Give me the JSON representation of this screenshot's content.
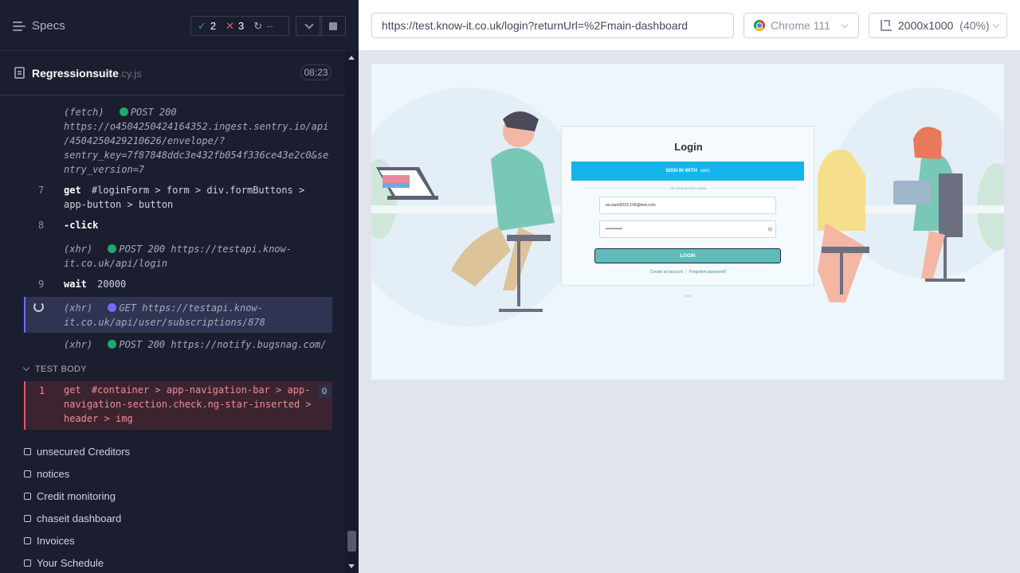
{
  "reporter": {
    "specs_label": "Specs",
    "stats": {
      "passed": "2",
      "failed": "3",
      "pending": "--"
    },
    "spec_file": {
      "name": "Regressionsuite",
      "ext": ".cy.js",
      "duration": "08:23"
    },
    "log": [
      {
        "kind": "fetch",
        "label": "(fetch)",
        "method": "POST 200",
        "text": "https://o4504250424164352.ingest.sentry.io/api/4504250429210626/envelope/?sentry_key=7f87848ddc3e432fb054f336ce43e2c0&sentry_version=7",
        "line1": "https://o4504250424164352.ingest.sentry.io/api",
        "line2": "/4504250429210626/envelope/?",
        "line3": "sentry_key=7f87848ddc3e432fb054f336ce43e2c0&se",
        "line4": "ntry_version=7"
      },
      {
        "kind": "cmd",
        "num": "7",
        "cmd": "get",
        "arg1": "#loginForm > form > div.formButtons >",
        "arg2": "app-button > button"
      },
      {
        "kind": "cmd",
        "num": "8",
        "cmd": "-click"
      },
      {
        "kind": "xhr",
        "label": "(xhr)",
        "method": "POST 200",
        "line1": "https://testapi.know-",
        "line2": "it.co.uk/api/login"
      },
      {
        "kind": "cmd",
        "num": "9",
        "cmd": "wait",
        "arg1": "20000"
      },
      {
        "kind": "xhr-active",
        "label": "(xhr)",
        "method": "GET",
        "line1": "https://testapi.know-",
        "line2": "it.co.uk/api/user/subscriptions/878"
      },
      {
        "kind": "xhr",
        "label": "(xhr)",
        "method": "POST 200",
        "line1": "https://notify.bugsnag.com/"
      }
    ],
    "test_body_label": "TEST BODY",
    "failed_cmd": {
      "num": "1",
      "cmd": "get",
      "arg1": "#container > app-navigation-bar > app-",
      "arg2": "navigation-section.check.ng-star-inserted >",
      "arg3": "header > img",
      "badge": "0"
    },
    "tests": [
      "unsecured Creditors",
      "notices",
      "Credit monitoring",
      "chaseit dashboard",
      "Invoices",
      "Your Schedule"
    ]
  },
  "preview": {
    "url": "https://test.know-it.co.uk/login?returnUrl=%2Fmain-dashboard",
    "browser": "Chrome 111",
    "viewport": "2000x1000",
    "zoom": "(40%)",
    "app": {
      "title": "Login",
      "xero_button": "SIGN IN WITH",
      "xero_brand": "xero",
      "or_text": "OR SIGN IN WITH EMAIL",
      "email_value": "account2023-106@test.com",
      "password_value": "••••••••••••",
      "login_button": "LOGIN",
      "create_account": "Create an account",
      "link_sep": "|",
      "forgotten_password": "Forgotten password?",
      "version": "TEST"
    }
  },
  "colors": {
    "reporter_bg": "#1b1e2e",
    "accent_pass": "#1fa971",
    "accent_fail": "#e45770",
    "accent_active": "#6d6df5",
    "xero_blue": "#13b5ea",
    "login_teal": "#5fbcba"
  }
}
